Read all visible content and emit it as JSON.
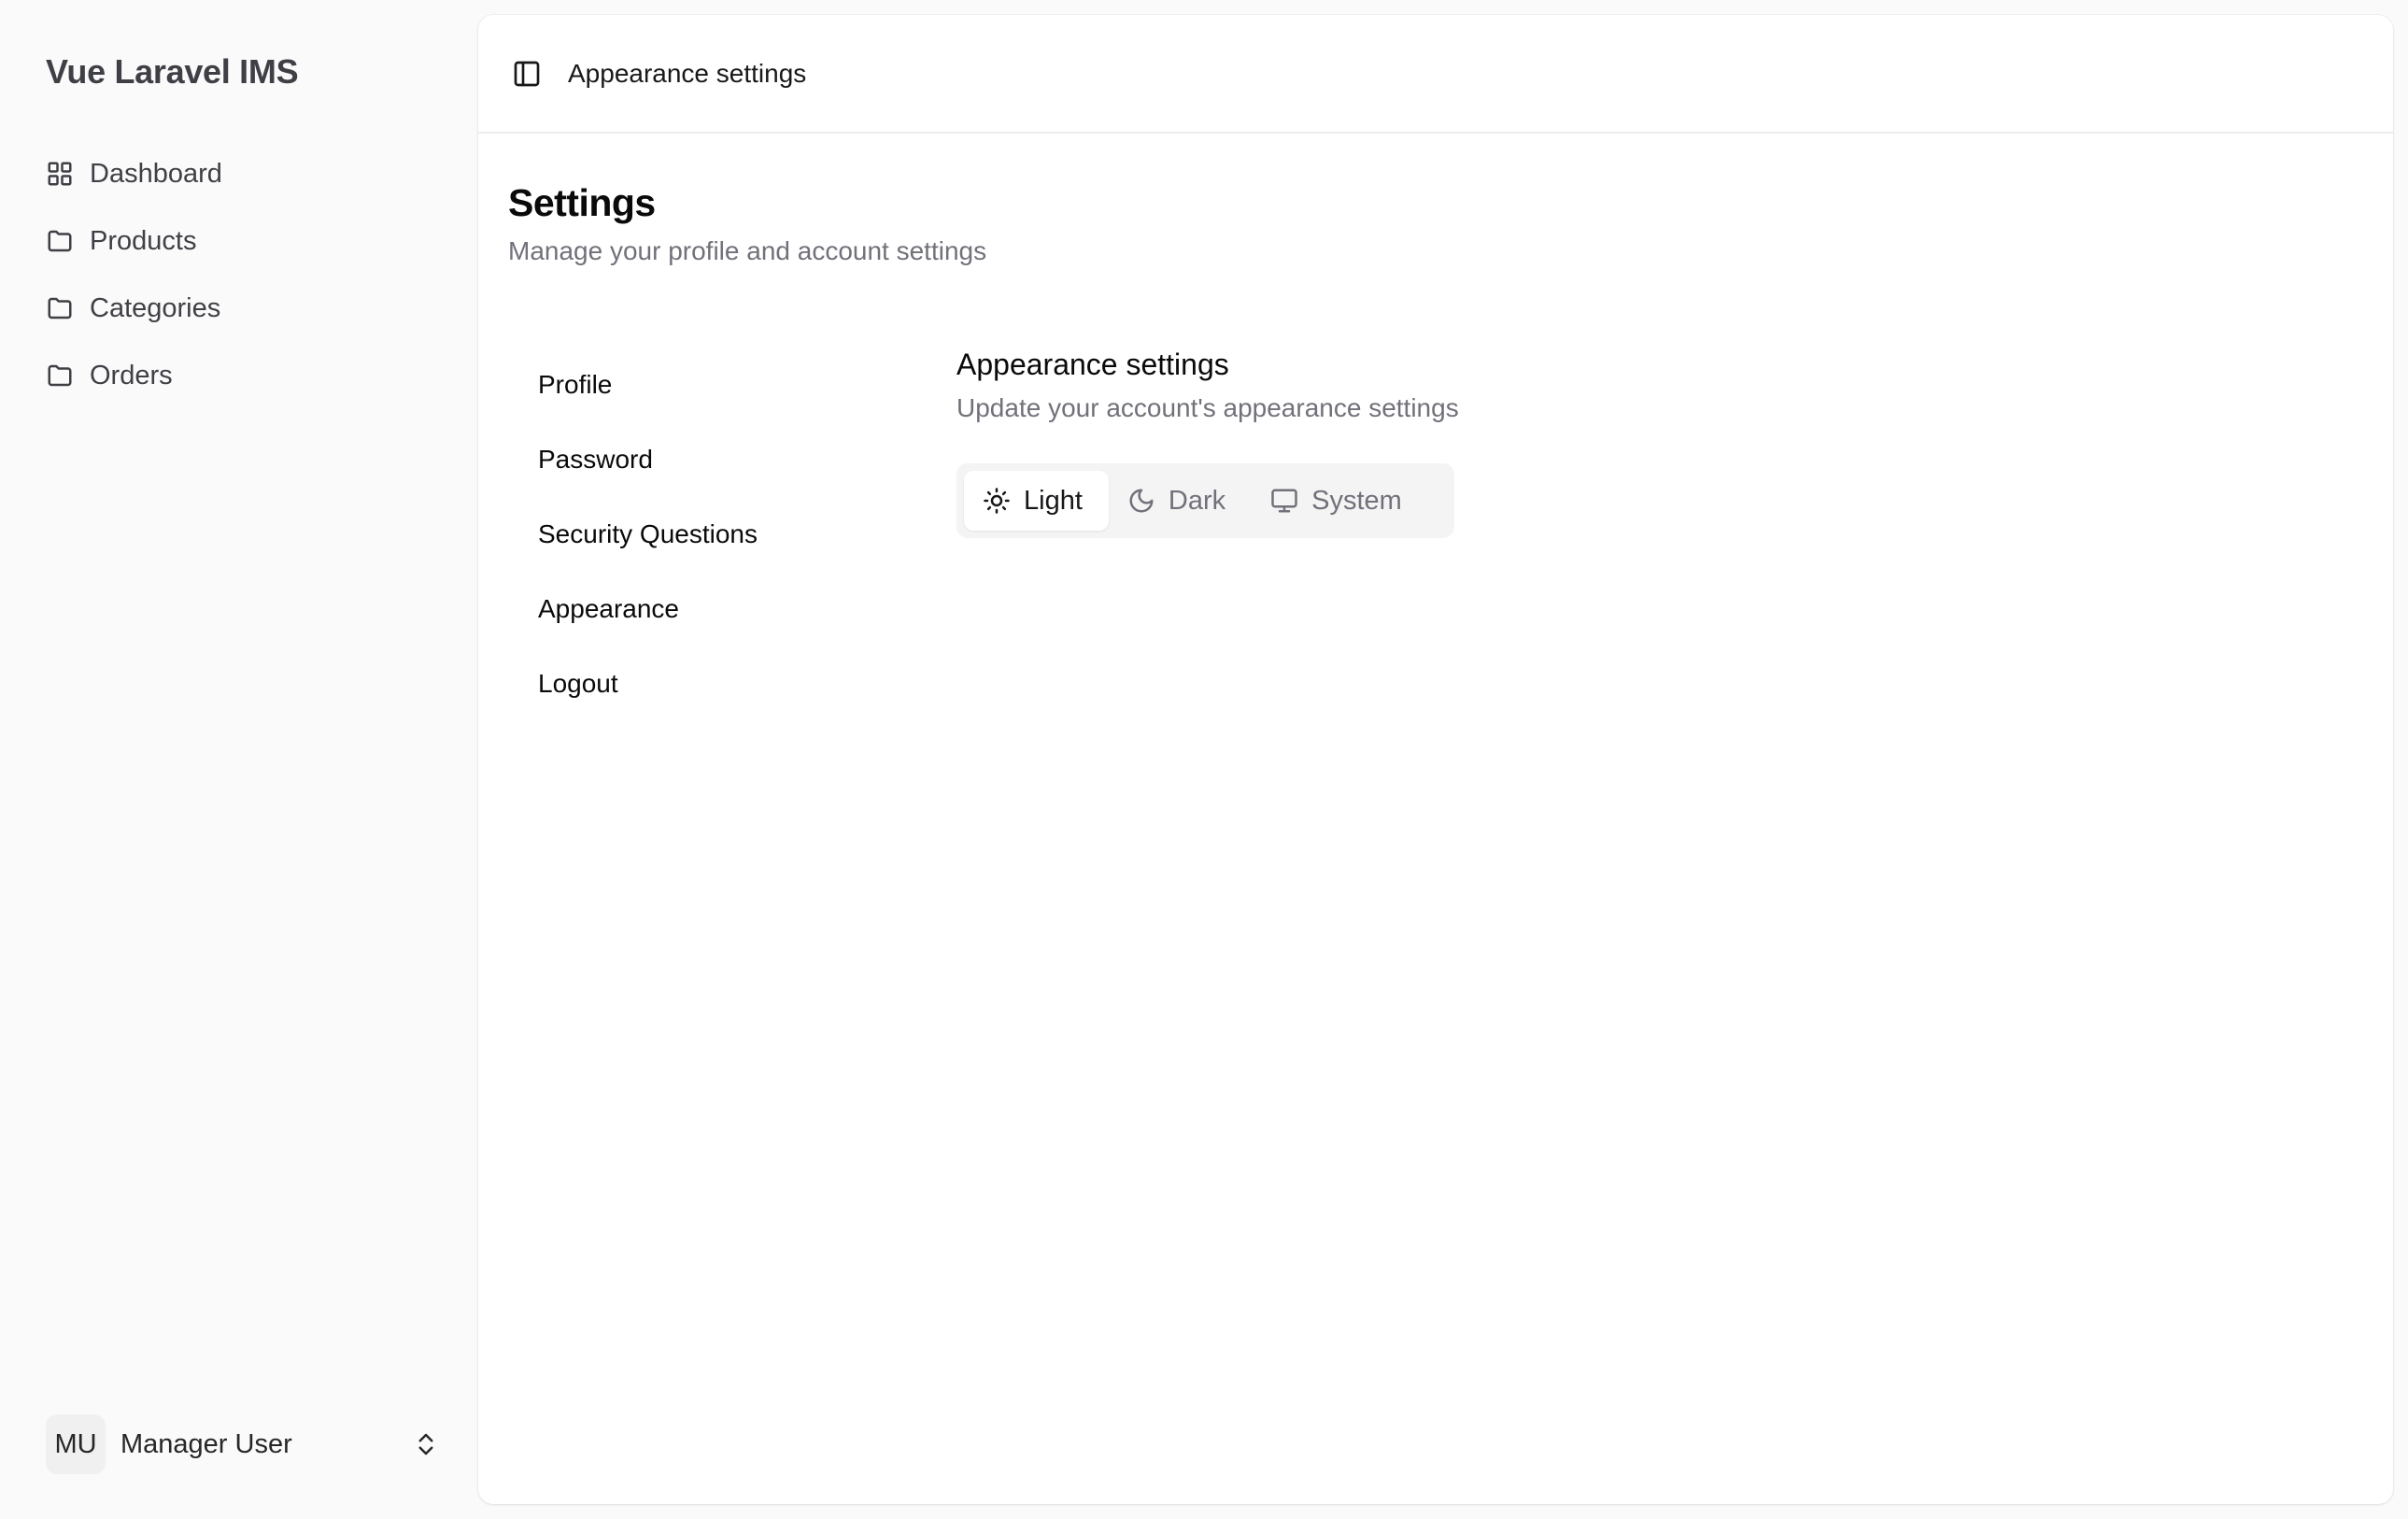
{
  "app": {
    "title": "Vue Laravel IMS"
  },
  "sidebar": {
    "items": [
      {
        "label": "Dashboard",
        "icon": "grid-icon"
      },
      {
        "label": "Products",
        "icon": "folder-icon"
      },
      {
        "label": "Categories",
        "icon": "folder-icon"
      },
      {
        "label": "Orders",
        "icon": "folder-icon"
      }
    ],
    "user": {
      "initials": "MU",
      "name": "Manager User"
    }
  },
  "topbar": {
    "title": "Appearance settings"
  },
  "page": {
    "title": "Settings",
    "subtitle": "Manage your profile and account settings"
  },
  "settings_nav": [
    {
      "label": "Profile"
    },
    {
      "label": "Password"
    },
    {
      "label": "Security Questions"
    },
    {
      "label": "Appearance"
    },
    {
      "label": "Logout"
    }
  ],
  "appearance": {
    "title": "Appearance settings",
    "subtitle": "Update your account's appearance settings",
    "options": [
      {
        "label": "Light",
        "icon": "sun-icon",
        "selected": true
      },
      {
        "label": "Dark",
        "icon": "moon-icon",
        "selected": false
      },
      {
        "label": "System",
        "icon": "monitor-icon",
        "selected": false
      }
    ]
  }
}
